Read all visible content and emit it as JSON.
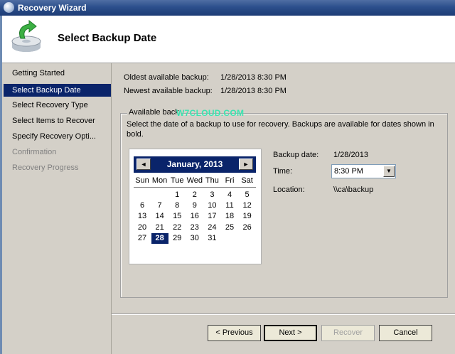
{
  "window": {
    "title": "Recovery Wizard"
  },
  "header": {
    "title": "Select Backup Date"
  },
  "nav": {
    "items": [
      {
        "label": "Getting Started",
        "state": "normal"
      },
      {
        "label": "Select Backup Date",
        "state": "selected"
      },
      {
        "label": "Select Recovery Type",
        "state": "normal"
      },
      {
        "label": "Select Items to Recover",
        "state": "normal"
      },
      {
        "label": "Specify Recovery Opti...",
        "state": "normal"
      },
      {
        "label": "Confirmation",
        "state": "disabled"
      },
      {
        "label": "Recovery Progress",
        "state": "disabled"
      }
    ]
  },
  "info": {
    "oldest_label": "Oldest available backup:",
    "oldest_value": "1/28/2013 8:30 PM",
    "newest_label": "Newest available backup:",
    "newest_value": "1/28/2013 8:30 PM"
  },
  "group": {
    "legend": "Available back",
    "watermark": "W7CLOUD.COM",
    "description": "Select the date of a backup to use for recovery. Backups are available for dates shown in bold."
  },
  "calendar": {
    "month_title": "January, 2013",
    "prev_icon": "◄",
    "next_icon": "►",
    "weekdays": [
      "Sun",
      "Mon",
      "Tue",
      "Wed",
      "Thu",
      "Fri",
      "Sat"
    ],
    "weeks": [
      [
        "",
        "",
        "1",
        "2",
        "3",
        "4",
        "5"
      ],
      [
        "6",
        "7",
        "8",
        "9",
        "10",
        "11",
        "12"
      ],
      [
        "13",
        "14",
        "15",
        "16",
        "17",
        "18",
        "19"
      ],
      [
        "20",
        "21",
        "22",
        "23",
        "24",
        "25",
        "26"
      ],
      [
        "27",
        "28",
        "29",
        "30",
        "31",
        "",
        ""
      ]
    ],
    "selected_day": "28"
  },
  "details": {
    "backup_date_label": "Backup date:",
    "backup_date_value": "1/28/2013",
    "time_label": "Time:",
    "time_value": "8:30 PM",
    "location_label": "Location:",
    "location_value": "\\\\ca\\backup"
  },
  "buttons": {
    "previous": "< Previous",
    "next": "Next >",
    "recover": "Recover",
    "cancel": "Cancel"
  }
}
